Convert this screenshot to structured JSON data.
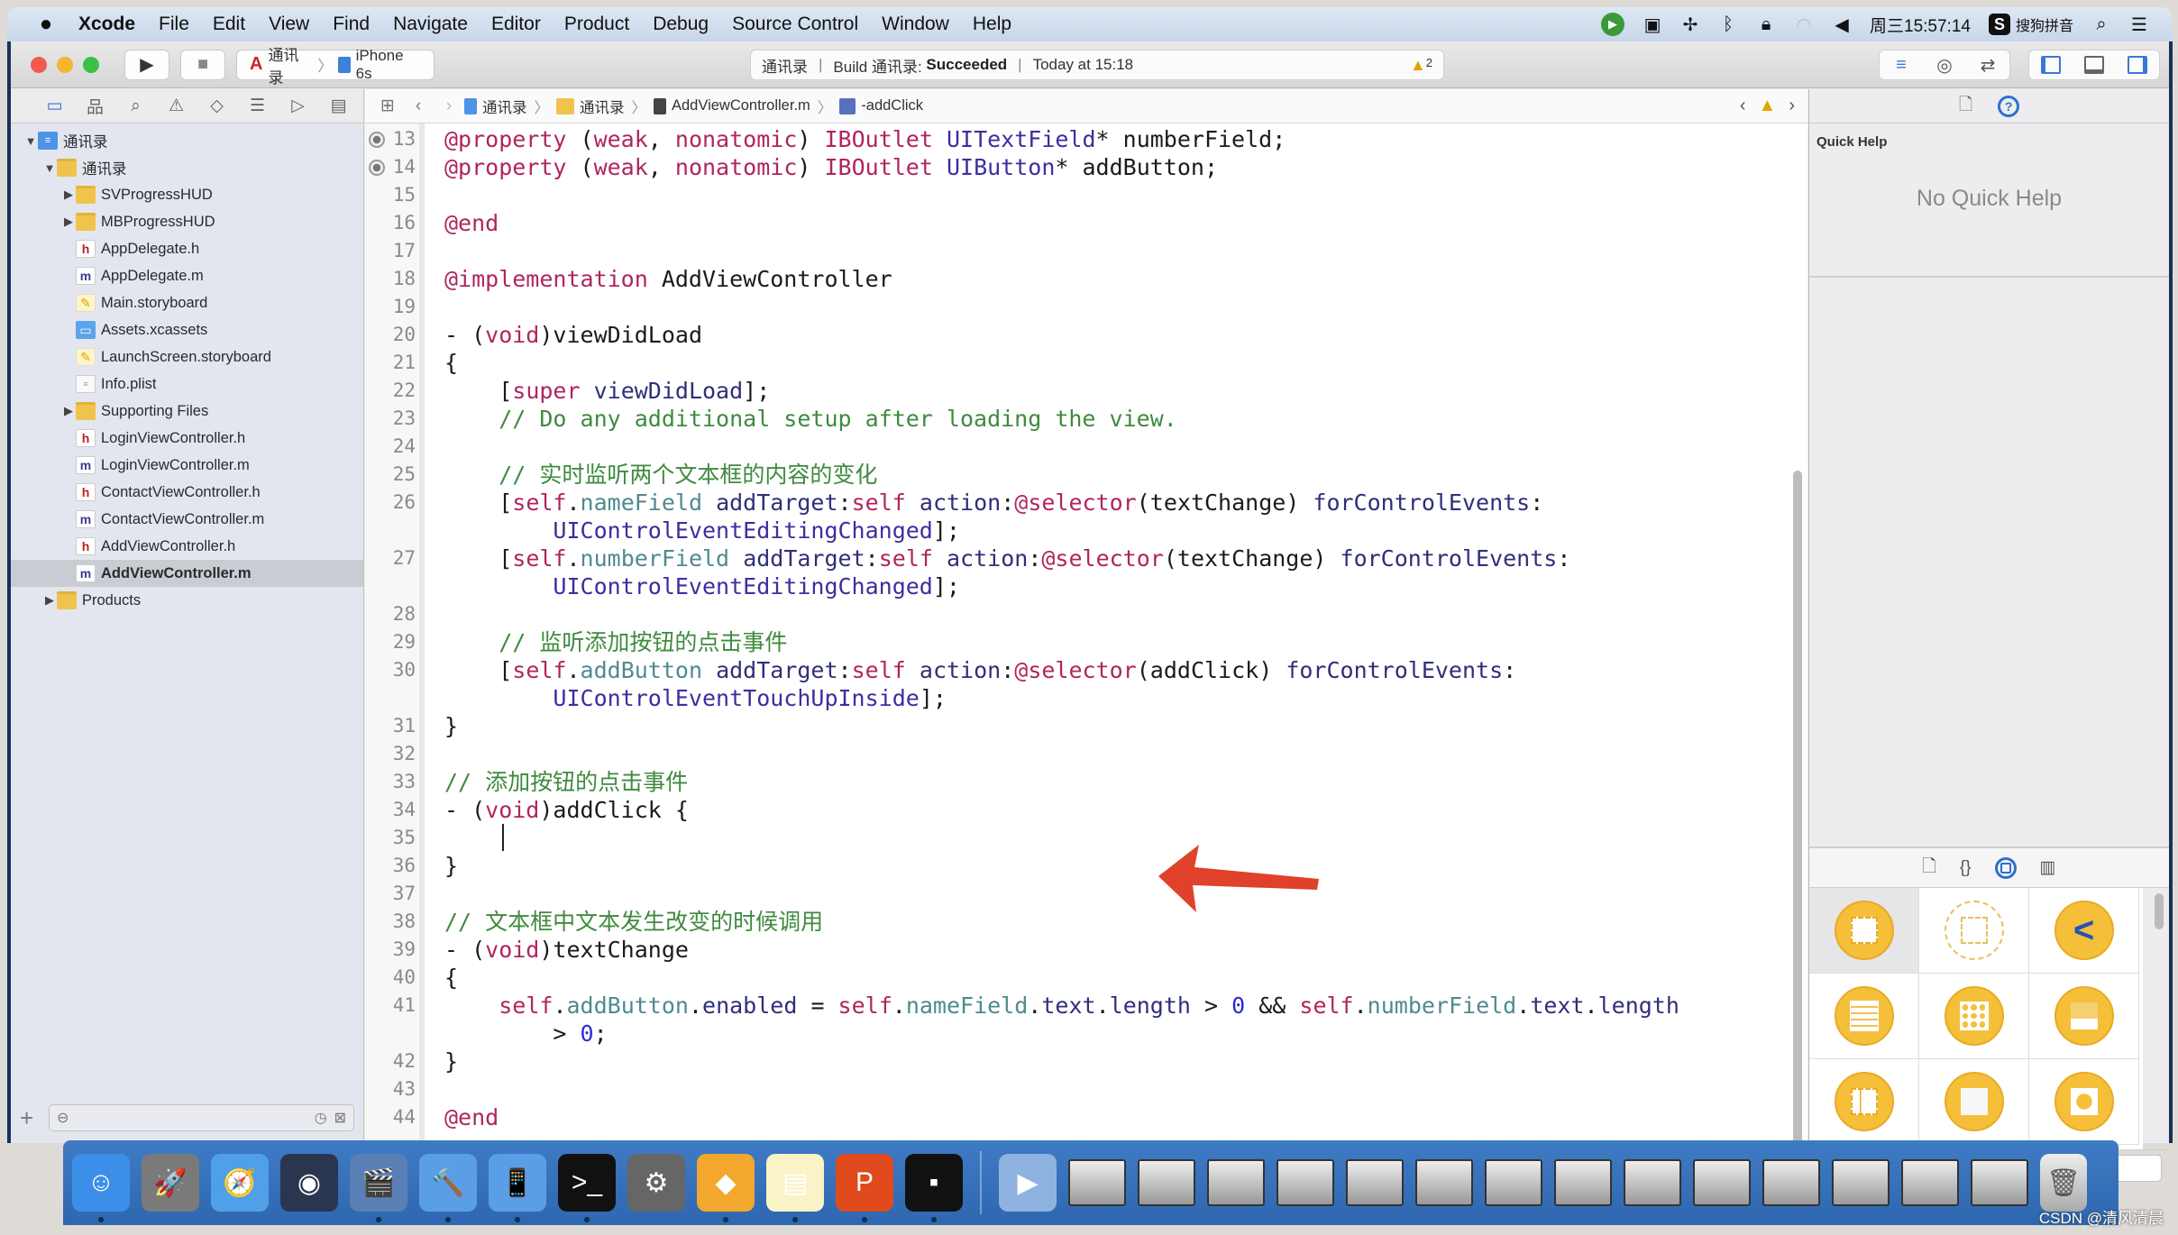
{
  "menubar": {
    "apple_icon": "apple-logo",
    "items": [
      "Xcode",
      "File",
      "Edit",
      "View",
      "Find",
      "Navigate",
      "Editor",
      "Product",
      "Debug",
      "Source Control",
      "Window",
      "Help"
    ],
    "clock": "周三15:57:14",
    "input_method": "搜狗拼音",
    "status_icons": [
      "green-circle-icon",
      "camera-icon",
      "fan-icon",
      "bluetooth-icon",
      "lock-icon",
      "wifi-icon",
      "volume-icon"
    ]
  },
  "toolbar": {
    "run_icon": "▶",
    "stop_icon": "■",
    "scheme": "通讯录",
    "device": "iPhone 6s",
    "activity": {
      "project": "通讯录",
      "build_label": "Build 通讯录:",
      "build_status": "Succeeded",
      "time": "Today at 15:18",
      "warning_count": "2"
    }
  },
  "navigator": {
    "tabs": [
      "project-navigator",
      "symbol-navigator",
      "find-navigator",
      "issue-navigator",
      "test-navigator",
      "debug-navigator",
      "breakpoint-navigator",
      "report-navigator"
    ],
    "tree": [
      {
        "label": "通讯录",
        "type": "project",
        "depth": 0,
        "disclosure": "open"
      },
      {
        "label": "通讯录",
        "type": "folder",
        "depth": 1,
        "disclosure": "open"
      },
      {
        "label": "SVProgressHUD",
        "type": "folder",
        "depth": 2,
        "disclosure": "closed"
      },
      {
        "label": "MBProgressHUD",
        "type": "folder",
        "depth": 2,
        "disclosure": "closed"
      },
      {
        "label": "AppDelegate.h",
        "type": "h",
        "depth": 2
      },
      {
        "label": "AppDelegate.m",
        "type": "m",
        "depth": 2
      },
      {
        "label": "Main.storyboard",
        "type": "story",
        "depth": 2
      },
      {
        "label": "Assets.xcassets",
        "type": "assets",
        "depth": 2
      },
      {
        "label": "LaunchScreen.storyboard",
        "type": "story",
        "depth": 2
      },
      {
        "label": "Info.plist",
        "type": "plist",
        "depth": 2
      },
      {
        "label": "Supporting Files",
        "type": "folder",
        "depth": 2,
        "disclosure": "closed"
      },
      {
        "label": "LoginViewController.h",
        "type": "h",
        "depth": 2
      },
      {
        "label": "LoginViewController.m",
        "type": "m",
        "depth": 2
      },
      {
        "label": "ContactViewController.h",
        "type": "h",
        "depth": 2
      },
      {
        "label": "ContactViewController.m",
        "type": "m",
        "depth": 2
      },
      {
        "label": "AddViewController.h",
        "type": "h",
        "depth": 2
      },
      {
        "label": "AddViewController.m",
        "type": "m",
        "depth": 2,
        "selected": true
      },
      {
        "label": "Products",
        "type": "folder",
        "depth": 1,
        "disclosure": "closed"
      }
    ],
    "filter_placeholder": ""
  },
  "jumpbar": {
    "crumbs": [
      "通讯录",
      "通讯录",
      "AddViewController.m",
      "-addClick"
    ]
  },
  "editor": {
    "caret_line": 35,
    "lines": [
      {
        "n": 13,
        "bp": true,
        "html": "<span class='kw'>@property</span> (<span class='kw'>weak</span>, <span class='kw'>nonatomic</span>) <span class='kw'>IBOutlet</span> <span class='ty'>UITextField</span>* numberField;"
      },
      {
        "n": 14,
        "bp": true,
        "html": "<span class='kw'>@property</span> (<span class='kw'>weak</span>, <span class='kw'>nonatomic</span>) <span class='kw'>IBOutlet</span> <span class='ty'>UIButton</span>* addButton;"
      },
      {
        "n": 15,
        "html": ""
      },
      {
        "n": 16,
        "html": "<span class='kw'>@end</span>"
      },
      {
        "n": 17,
        "html": ""
      },
      {
        "n": 18,
        "html": "<span class='kw'>@implementation</span> AddViewController"
      },
      {
        "n": 19,
        "html": ""
      },
      {
        "n": 20,
        "html": "- (<span class='kw'>void</span>)viewDidLoad"
      },
      {
        "n": 21,
        "html": "{"
      },
      {
        "n": 22,
        "html": "    [<span class='kw'>super</span> <span class='me'>viewDidLoad</span>];"
      },
      {
        "n": 23,
        "html": "    <span class='cm'>// Do any additional setup after loading the view.</span>"
      },
      {
        "n": 24,
        "html": ""
      },
      {
        "n": 25,
        "html": "    <span class='cm'>// 实时监听两个文本框的内容的变化</span>"
      },
      {
        "n": 26,
        "html": "    [<span class='kw'>self</span>.<span class='pr'>nameField</span> <span class='me'>addTarget</span>:<span class='kw'>self</span> <span class='me'>action</span>:<span class='kw'>@selector</span>(textChange) <span class='me'>forControlEvents</span>:"
      },
      {
        "n": null,
        "html": "        <span class='ty'>UIControlEventEditingChanged</span>];"
      },
      {
        "n": 27,
        "html": "    [<span class='kw'>self</span>.<span class='pr'>numberField</span> <span class='me'>addTarget</span>:<span class='kw'>self</span> <span class='me'>action</span>:<span class='kw'>@selector</span>(textChange) <span class='me'>forControlEvents</span>:"
      },
      {
        "n": null,
        "html": "        <span class='ty'>UIControlEventEditingChanged</span>];"
      },
      {
        "n": 28,
        "html": ""
      },
      {
        "n": 29,
        "html": "    <span class='cm'>// 监听添加按钮的点击事件</span>"
      },
      {
        "n": 30,
        "html": "    [<span class='kw'>self</span>.<span class='pr'>addButton</span> <span class='me'>addTarget</span>:<span class='kw'>self</span> <span class='me'>action</span>:<span class='kw'>@selector</span>(addClick) <span class='me'>forControlEvents</span>:"
      },
      {
        "n": null,
        "html": "        <span class='ty'>UIControlEventTouchUpInside</span>];"
      },
      {
        "n": 31,
        "html": "}"
      },
      {
        "n": 32,
        "html": ""
      },
      {
        "n": 33,
        "html": "<span class='cm'>// 添加按钮的点击事件</span>"
      },
      {
        "n": 34,
        "html": "- (<span class='kw'>void</span>)addClick {"
      },
      {
        "n": 35,
        "html": ""
      },
      {
        "n": 36,
        "html": "}"
      },
      {
        "n": 37,
        "html": ""
      },
      {
        "n": 38,
        "html": "<span class='cm'>// 文本框中文本发生改变的时候调用</span>"
      },
      {
        "n": 39,
        "html": "- (<span class='kw'>void</span>)textChange"
      },
      {
        "n": 40,
        "html": "{"
      },
      {
        "n": 41,
        "html": "    <span class='kw'>self</span>.<span class='pr'>addButton</span>.<span class='me'>enabled</span> = <span class='kw'>self</span>.<span class='pr'>nameField</span>.<span class='me'>text</span>.<span class='me'>length</span> &gt; <span class='num'>0</span> &amp;&amp; <span class='kw'>self</span>.<span class='pr'>numberField</span>.<span class='me'>text</span>.<span class='me'>length</span>"
      },
      {
        "n": null,
        "html": "        &gt; <span class='num'>0</span>;"
      },
      {
        "n": 42,
        "html": "}"
      },
      {
        "n": 43,
        "html": ""
      },
      {
        "n": 44,
        "html": "<span class='kw'>@end</span>"
      }
    ]
  },
  "inspector": {
    "tabs": [
      "file-inspector",
      "quick-help-inspector"
    ],
    "quick_help_title": "Quick Help",
    "quick_help_empty": "No Quick Help",
    "library_tabs": [
      "file-template-library",
      "code-snippet-library",
      "object-library",
      "media-library"
    ],
    "library_objects": [
      "view-controller",
      "storyboard-reference",
      "navigation-controller",
      "table-view-controller",
      "collection-view-controller",
      "tab-bar-controller",
      "split-view-controller",
      "page-view-controller",
      "glkit-view-controller"
    ]
  },
  "dock": {
    "apps": [
      {
        "name": "finder",
        "glyph": "☺",
        "bg": "#3b8fe8",
        "running": true
      },
      {
        "name": "launchpad",
        "glyph": "🚀",
        "bg": "#7a7a7a",
        "running": false
      },
      {
        "name": "safari",
        "glyph": "🧭",
        "bg": "#4fa0e8",
        "running": false
      },
      {
        "name": "mouse-app",
        "glyph": "◉",
        "bg": "#2a3550",
        "running": false
      },
      {
        "name": "imovie",
        "glyph": "🎬",
        "bg": "#5a7fb5",
        "running": true
      },
      {
        "name": "xcode",
        "glyph": "🔨",
        "bg": "#5a9ee8",
        "running": true
      },
      {
        "name": "simulator",
        "glyph": "📱",
        "bg": "#5a9ee8",
        "running": true
      },
      {
        "name": "terminal",
        "glyph": ">_",
        "bg": "#111111",
        "running": true
      },
      {
        "name": "system-preferences",
        "glyph": "⚙",
        "bg": "#666666",
        "running": false
      },
      {
        "name": "sketch",
        "glyph": "◆",
        "bg": "#f3a72c",
        "running": true
      },
      {
        "name": "notes",
        "glyph": "▤",
        "bg": "#fbf3c8",
        "running": true
      },
      {
        "name": "wps-presentation",
        "glyph": "P",
        "bg": "#e04a1c",
        "running": true
      },
      {
        "name": "console",
        "glyph": "▪",
        "bg": "#111111",
        "running": true
      }
    ],
    "minimized_windows": 14,
    "trash_icon": "trash-icon"
  },
  "watermark": "CSDN @清风清晨",
  "colors": {
    "accent": "#2f6fd0",
    "warning": "#e0a400",
    "keyword": "#b0255f",
    "comment": "#3f8a3f",
    "annotation_arrow": "#e0412a"
  }
}
